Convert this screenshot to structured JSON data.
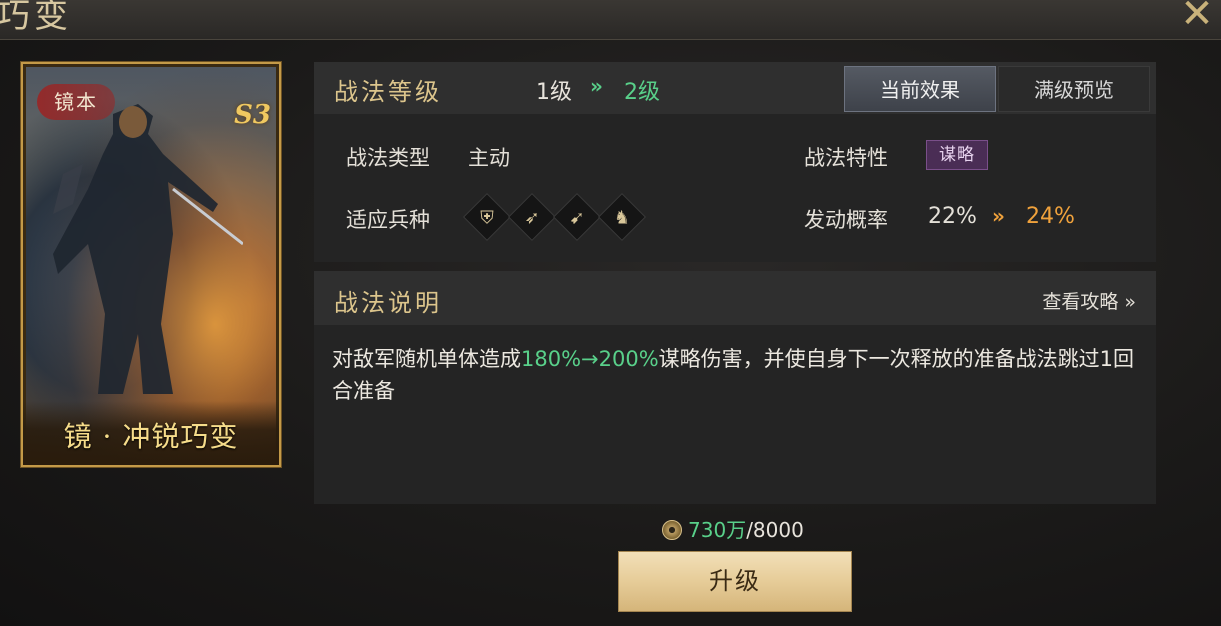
{
  "window": {
    "title": "巧变",
    "close_icon": "close-x-icon"
  },
  "card": {
    "badge": "镜本",
    "season": "S3",
    "name": "镜 · 冲锐巧变"
  },
  "level": {
    "title": "战法等级",
    "from": "1级",
    "arrow": "»",
    "to": "2级"
  },
  "tabs": {
    "current": "当前效果",
    "max_preview": "满级预览"
  },
  "attributes": {
    "type_label": "战法类型",
    "type_value": "主动",
    "trait_label": "战法特性",
    "trait_value": "谋略",
    "units_label": "适应兵种",
    "units": [
      {
        "name": "shield-icon",
        "glyph": "⛨"
      },
      {
        "name": "bow-icon",
        "glyph": "➶"
      },
      {
        "name": "spear-icon",
        "glyph": "➹"
      },
      {
        "name": "horse-icon",
        "glyph": "♞"
      }
    ],
    "rate_label": "发动概率",
    "rate_from": "22%",
    "rate_arrow": "»",
    "rate_to": "24%"
  },
  "description": {
    "title": "战法说明",
    "guide_link": "查看攻略 »",
    "text_pre": "对敌军随机单体造成",
    "text_hl": "180%→200%",
    "text_post": "谋略伤害，并使自身下一次释放的准备战法跳过1回合准备"
  },
  "cost": {
    "have": "730万",
    "need": "/8000"
  },
  "upgrade_button": "升级",
  "colors": {
    "gold": "#dcc58c",
    "green": "#59d08a",
    "orange": "#f0a23c",
    "trait_purple": "#4a2d55"
  }
}
